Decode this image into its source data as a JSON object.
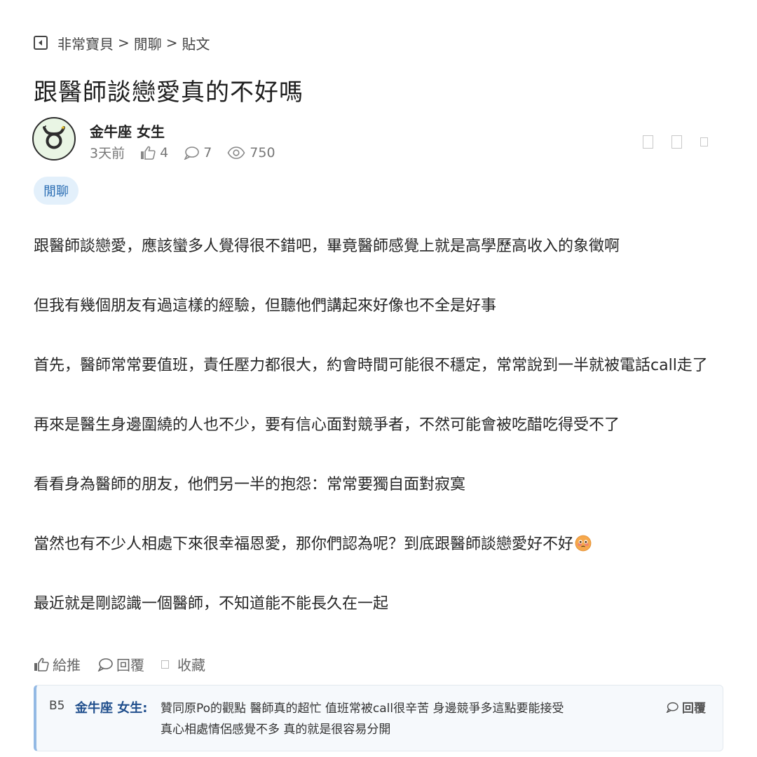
{
  "breadcrumb": {
    "items": [
      "非常寶貝",
      "閒聊",
      "貼文"
    ],
    "separator": ">"
  },
  "post": {
    "title": "跟醫師談戀愛真的不好嗎",
    "author": "金牛座 女生",
    "time": "3天前",
    "likes": "4",
    "comments": "7",
    "views": "750",
    "tag": "閒聊",
    "paragraphs": [
      "跟醫師談戀愛，應該蠻多人覺得很不錯吧，畢竟醫師感覺上就是高學歷高收入的象徵啊",
      "但我有幾個朋友有過這樣的經驗，但聽他們講起來好像也不全是好事",
      "首先，醫師常常要值班，責任壓力都很大，約會時間可能很不穩定，常常說到一半就被電話call走了",
      "再來是醫生身邊圍繞的人也不少，要有信心面對競爭者，不然可能會被吃醋吃得受不了",
      "看看身為醫師的朋友，他們另一半的抱怨：常常要獨自面對寂寞",
      "當然也有不少人相處下來很幸福恩愛，那你們認為呢？到底跟醫師談戀愛好不好",
      "最近就是剛認識一個醫師，不知道能不能長久在一起"
    ]
  },
  "post_actions": {
    "like": "給推",
    "reply": "回覆",
    "favorite": "收藏"
  },
  "comment": {
    "floor": "B5",
    "author": "金牛座 女生:",
    "line1": "贊同原Po的觀點 醫師真的超忙 值班常被call很辛苦 身邊競爭多這點要能接受",
    "line2": "真心相處情侶感覺不多 真的就是很容易分開",
    "reply": "回覆"
  },
  "colors": {
    "tag_bg": "#e3f0fb",
    "tag_text": "#2a6db3",
    "comment_author": "#1f4e8c",
    "comment_border": "#93b9e4",
    "avatar_bg": "#e9f5e4"
  },
  "icons": [
    "back-icon",
    "taurus-icon",
    "thumbs-up-icon",
    "comment-icon",
    "eye-icon",
    "bookmark-icon",
    "share-icon",
    "more-icon",
    "flushed-face-emoji"
  ]
}
